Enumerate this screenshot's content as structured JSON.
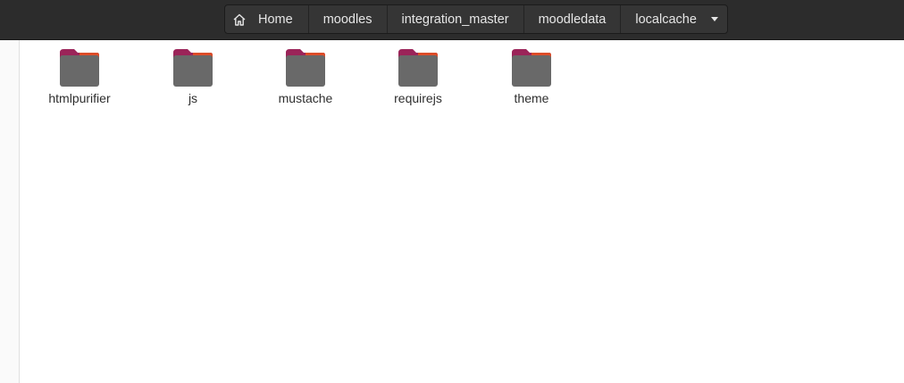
{
  "pathbar": {
    "items": [
      {
        "label": "Home",
        "icon": "home-icon"
      },
      {
        "label": "moodles"
      },
      {
        "label": "integration_master"
      },
      {
        "label": "moodledata"
      },
      {
        "label": "localcache",
        "icon": "dropdown-arrow-icon"
      }
    ]
  },
  "folders": [
    {
      "name": "htmlpurifier"
    },
    {
      "name": "js"
    },
    {
      "name": "mustache"
    },
    {
      "name": "requirejs"
    },
    {
      "name": "theme"
    }
  ],
  "colors": {
    "header_bg": "#2c2c2c",
    "folder_body": "#696969",
    "folder_tab": "#9b2459",
    "folder_tab_accent": "#e95420"
  }
}
